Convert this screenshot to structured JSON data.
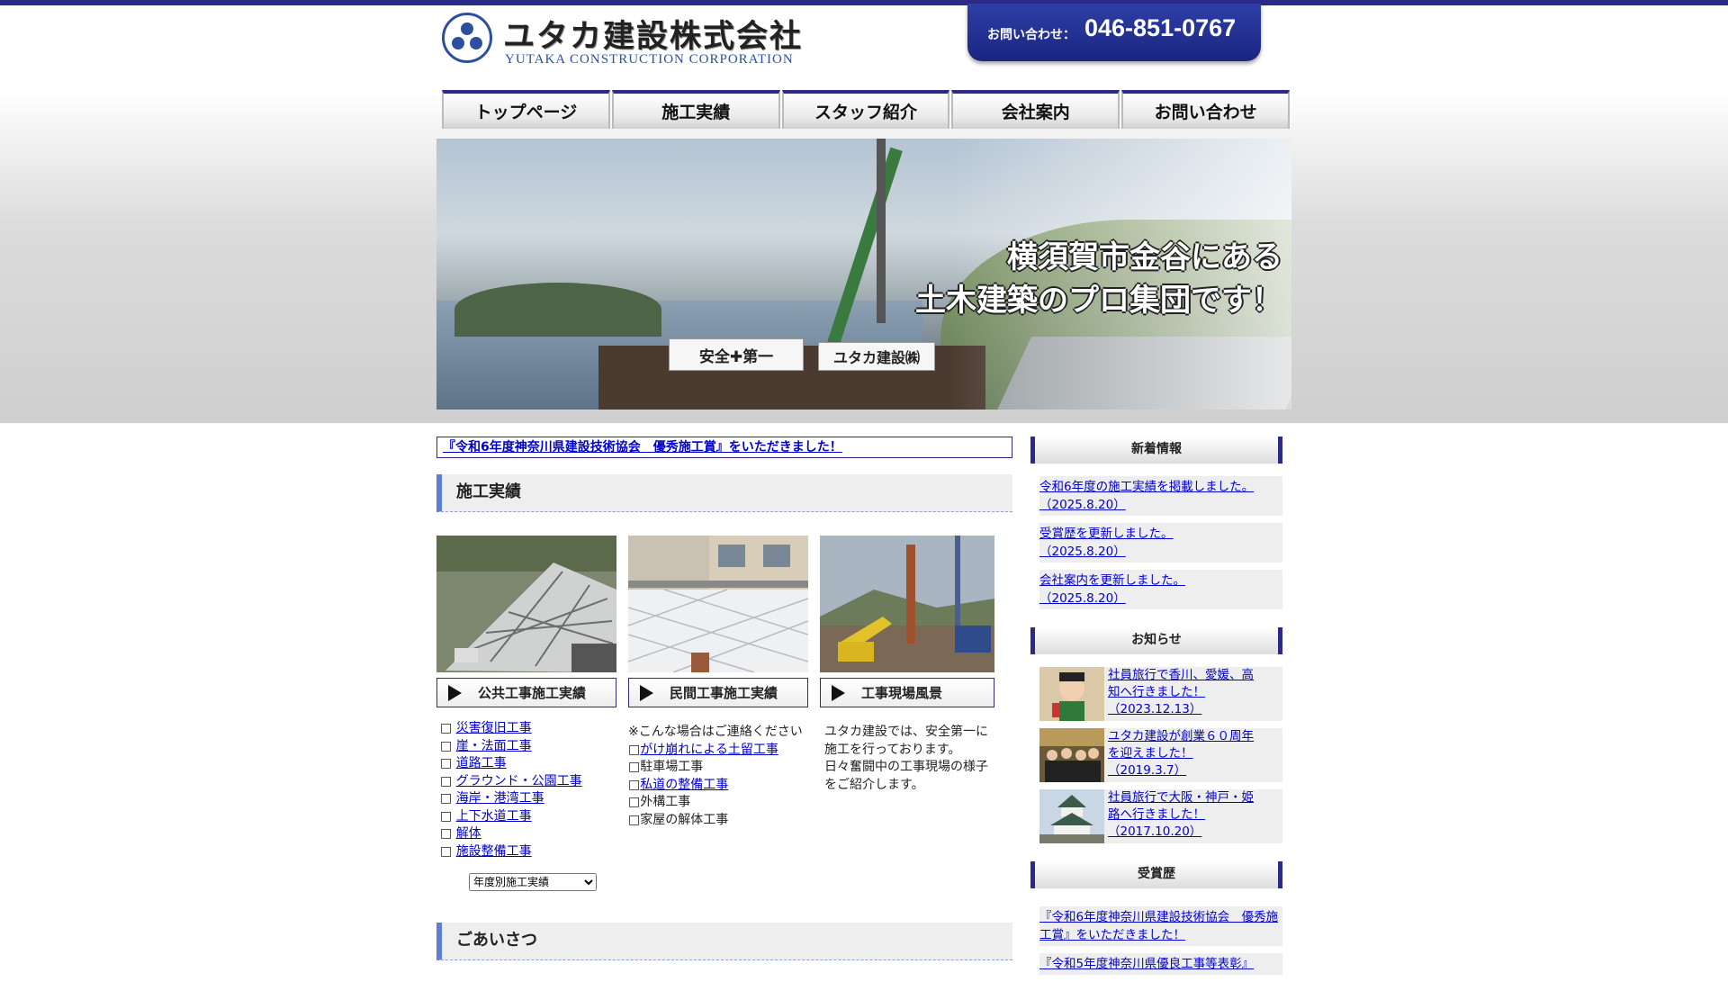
{
  "header": {
    "logo_jp": "ユタカ建設株式会社",
    "logo_en": "YUTAKA CONSTRUCTION CORPORATION",
    "contact_label": "お問い合わせ：",
    "contact_tel": "046-851-0767"
  },
  "nav": [
    "トップページ",
    "施工実績",
    "スタッフ紹介",
    "会社案内",
    "お問い合わせ"
  ],
  "hero": {
    "catch_line1": "横須賀市金谷にある",
    "catch_line2": "土木建築のプロ集団です！",
    "sign1": "安全✚第一",
    "sign2": "ユタカ建設㈱"
  },
  "main": {
    "ticker": "『令和6年度神奈川県建設技術協会　優秀施工賞』をいただきました！",
    "section_works": "施工実績",
    "section_greeting": "ごあいさつ",
    "cards": [
      {
        "button": "公共工事施工実績"
      },
      {
        "button": "民間工事施工実績"
      },
      {
        "button": "工事現場風景"
      }
    ],
    "public_list": [
      "災害復旧工事",
      "崖・法面工事",
      "道路工事",
      "グラウンド・公園工事",
      "海岸・港湾工事",
      "上下水道工事",
      "解体",
      "施設整備工事"
    ],
    "private_intro": "※こんな場合はご連絡ください",
    "private_list": [
      {
        "text": "がけ崩れによる土留工事",
        "link": true
      },
      {
        "text": "駐車場工事",
        "link": false
      },
      {
        "text": "私道の整備工事",
        "link": true
      },
      {
        "text": "外構工事",
        "link": false
      },
      {
        "text": "家屋の解体工事",
        "link": false
      }
    ],
    "site_text_1": "ユタカ建設では、安全第一に",
    "site_text_2": "施工を行っております。",
    "site_text_3": "日々奮闘中の工事現場の様子",
    "site_text_4": "をご紹介します。",
    "year_select": "年度別施工実績"
  },
  "sidebar": {
    "news_title": "新着情報",
    "news": [
      {
        "text": "令和6年度の施工実績を掲載しました。",
        "date": "（2025.8.20）"
      },
      {
        "text": "受賞歴を更新しました。",
        "date": "（2025.8.20）"
      },
      {
        "text": "会社案内を更新しました。",
        "date": "（2025.8.20）"
      }
    ],
    "notice_title": "お知らせ",
    "notices": [
      {
        "line1": "社員旅行で香川、愛媛、高",
        "line2": "知へ行きました！",
        "date": "（2023.12.13）"
      },
      {
        "line1": "ユタカ建設が創業６０周年",
        "line2": "を迎えました！",
        "date": "（2019.3.7）"
      },
      {
        "line1": "社員旅行で大阪・神戸・姫",
        "line2": "路へ行きました！",
        "date": "（2017.10.20）"
      }
    ],
    "awards_title": "受賞歴",
    "awards": [
      "『令和6年度神奈川県建設技術協会　優秀施工賞』をいただきました！",
      "『令和5年度神奈川県優良工事等表彰』"
    ]
  }
}
